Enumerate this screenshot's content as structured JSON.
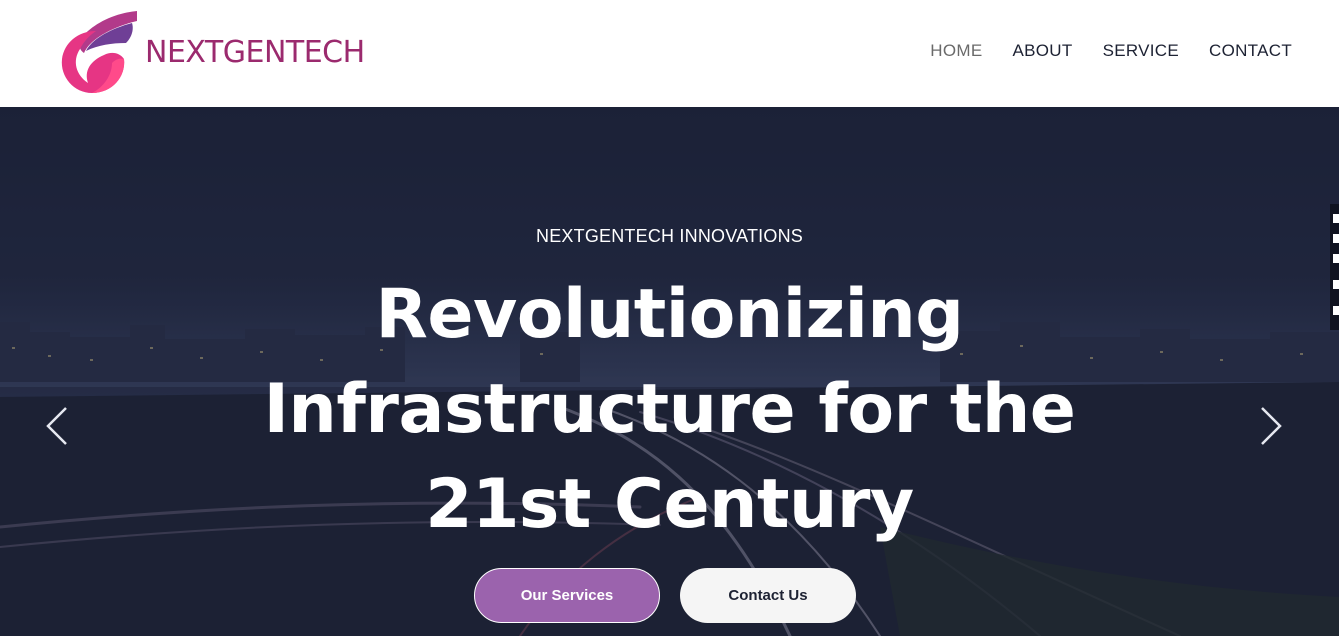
{
  "brand": {
    "name": "NEXTGENTECH",
    "logo_icon": "flame-logo-icon",
    "colors": {
      "pink": "#ff3d7f",
      "magenta": "#9b2a6e",
      "purple": "#6f3f96"
    }
  },
  "nav": {
    "items": [
      {
        "label": "HOME",
        "active": true
      },
      {
        "label": "ABOUT",
        "active": false
      },
      {
        "label": "SERVICE",
        "active": false
      },
      {
        "label": "CONTACT",
        "active": false
      }
    ]
  },
  "hero": {
    "eyebrow": "NEXTGENTECH INNOVATIONS",
    "headline_lines": [
      "Revolutionizing",
      "Infrastructure for the",
      "21st Century"
    ],
    "background_icon": "city-highway-night-image",
    "primary_button": "Our Services",
    "secondary_button": "Contact Us",
    "prev_icon": "chevron-left-icon",
    "next_icon": "chevron-right-icon",
    "colors": {
      "primary_button": "#9b63ad",
      "overlay": "#1c223a"
    }
  }
}
